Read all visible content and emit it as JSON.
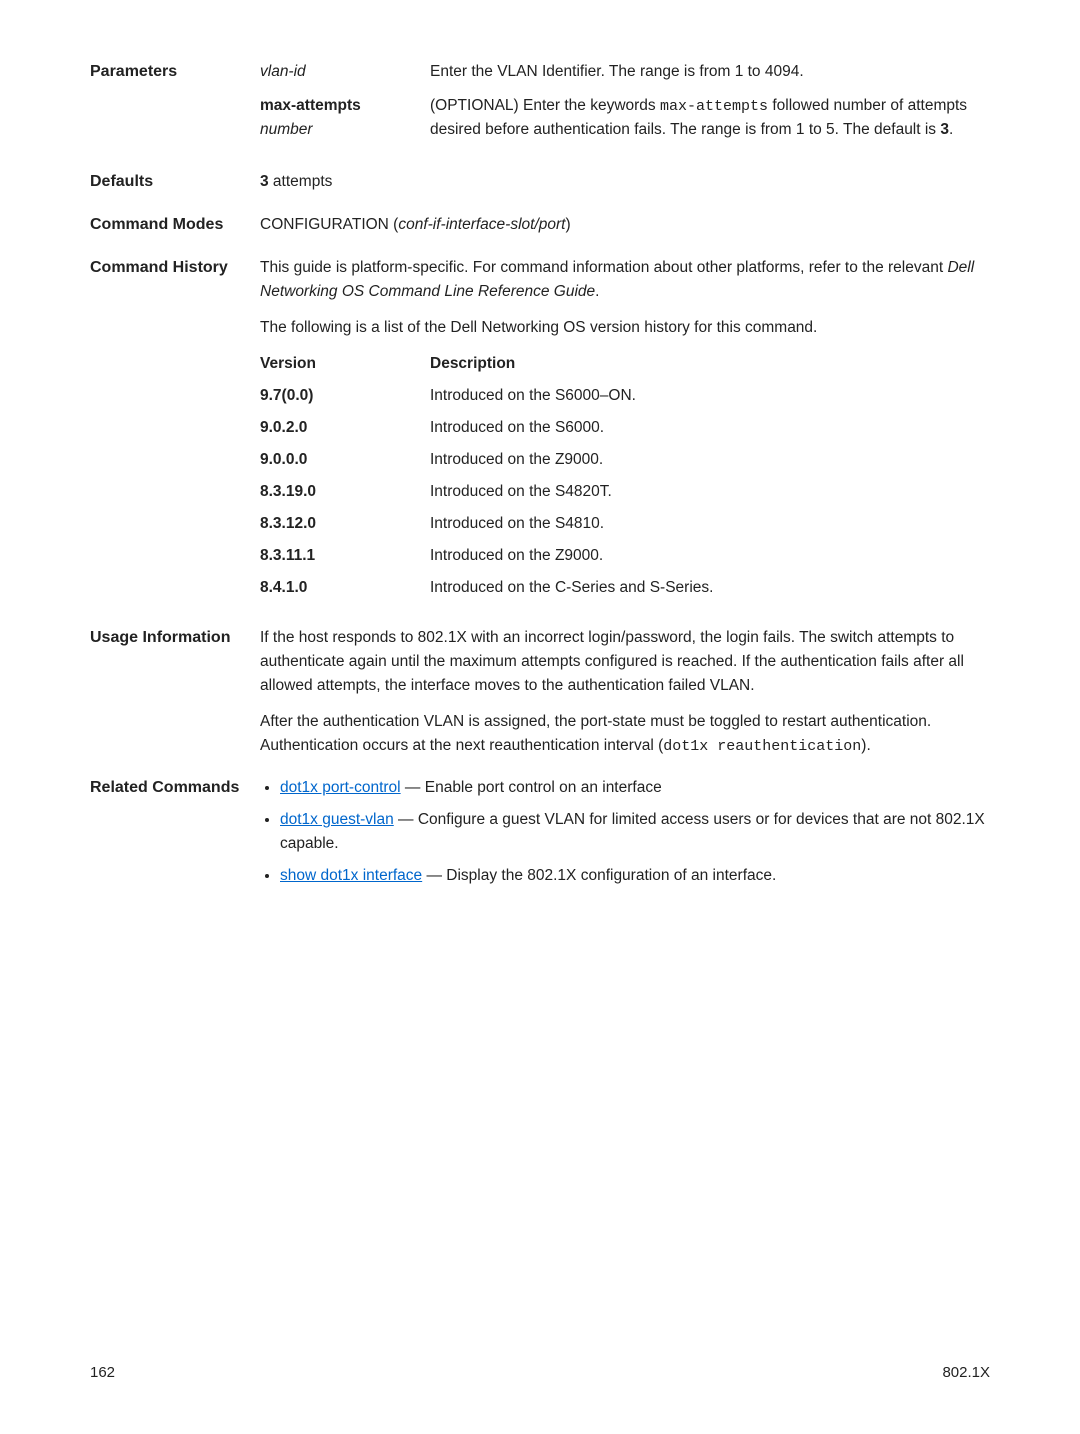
{
  "parameters": {
    "label": "Parameters",
    "rows": [
      {
        "name_italic": "vlan-id",
        "desc_parts": [
          "Enter the VLAN Identifier. The range is from 1 to 4094."
        ]
      },
      {
        "name_bold": "max-attempts",
        "name_italic2": "number",
        "desc_prefix": "(OPTIONAL) Enter the keywords ",
        "desc_code": "max-attempts",
        "desc_mid": " followed number of attempts desired before authentication fails. The range is from 1 to 5. The default is ",
        "desc_bold": "3",
        "desc_suffix": "."
      }
    ]
  },
  "defaults": {
    "label": "Defaults",
    "value_bold": "3",
    "value_rest": " attempts"
  },
  "command_modes": {
    "label": "Command Modes",
    "prefix": "CONFIGURATION (",
    "italic": "conf-if-interface-slot/port",
    "suffix": ")"
  },
  "command_history": {
    "label": "Command History",
    "para1_a": "This guide is platform-specific. For command information about other platforms, refer to the relevant ",
    "para1_i": "Dell Networking OS Command Line Reference Guide",
    "para1_b": ".",
    "para2": "The following is a list of the Dell Networking OS version history for this command.",
    "header_version": "Version",
    "header_desc": "Description",
    "versions": [
      {
        "v": "9.7(0.0)",
        "d": "Introduced on the S6000–ON."
      },
      {
        "v": "9.0.2.0",
        "d": "Introduced on the S6000."
      },
      {
        "v": "9.0.0.0",
        "d": "Introduced on the Z9000."
      },
      {
        "v": "8.3.19.0",
        "d": "Introduced on the S4820T."
      },
      {
        "v": "8.3.12.0",
        "d": "Introduced on the S4810."
      },
      {
        "v": "8.3.11.1",
        "d": "Introduced on the Z9000."
      },
      {
        "v": "8.4.1.0",
        "d": "Introduced on the C-Series and S-Series."
      }
    ]
  },
  "usage": {
    "label": "Usage Information",
    "para1": "If the host responds to 802.1X with an incorrect login/password, the login fails. The switch attempts to authenticate again until the maximum attempts configured is reached. If the authentication fails after all allowed attempts, the interface moves to the authentication failed VLAN.",
    "para2_a": "After the authentication VLAN is assigned, the port-state must be toggled to restart authentication. Authentication occurs at the next reauthentication interval (",
    "para2_code": "dot1x reauthentication",
    "para2_b": ")."
  },
  "related": {
    "label": "Related Commands",
    "items": [
      {
        "link": "dot1x port-control",
        "rest": " — Enable port control on an interface"
      },
      {
        "link": "dot1x guest-vlan",
        "rest": " — Configure a guest VLAN for limited access users or for devices that are not 802.1X capable."
      },
      {
        "link": "show dot1x interface",
        "rest": " — Display the 802.1X configuration of an interface."
      }
    ]
  },
  "footer": {
    "page": "162",
    "section": "802.1X"
  }
}
